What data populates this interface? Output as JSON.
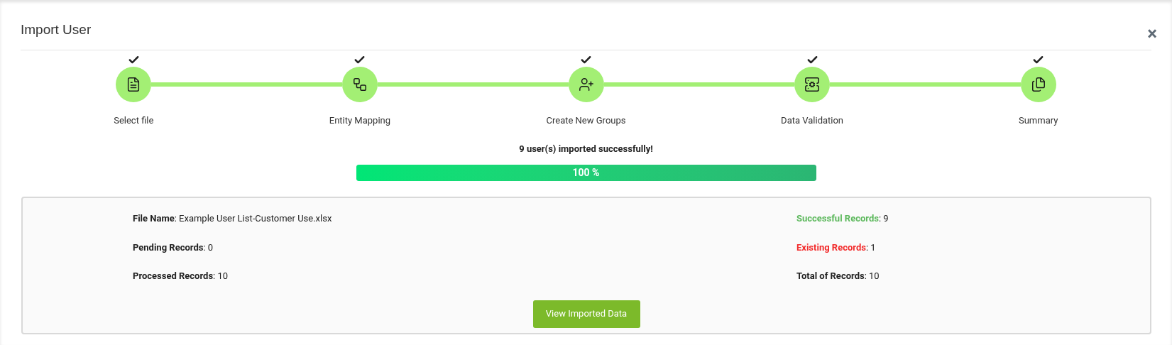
{
  "dialog": {
    "title": "Import User",
    "close": "×"
  },
  "steps": [
    {
      "label": "Select file",
      "completed": true
    },
    {
      "label": "Entity Mapping",
      "completed": true
    },
    {
      "label": "Create New Groups",
      "completed": true
    },
    {
      "label": "Data Validation",
      "completed": true
    },
    {
      "label": "Summary",
      "completed": true
    }
  ],
  "message": "9 user(s) imported successfully!",
  "progress": {
    "level": 1,
    "reading": "100 %"
  },
  "summary": {
    "left": [
      {
        "label": "File Name",
        "value": ": Example User List-Customer Use.xlsx",
        "color": "#212121"
      },
      {
        "label": "Pending Records",
        "value": ": 0",
        "color": "#212121"
      },
      {
        "label": "Processed Records",
        "value": ": 10",
        "color": "#212121"
      }
    ],
    "right": [
      {
        "label": "Successful Records",
        "value": ": 9",
        "color": "#5cb85c"
      },
      {
        "label": "Existing Records",
        "value": ": 1",
        "color": "#f22b2b"
      },
      {
        "label": "Total of Records",
        "value": ": 10",
        "color": "#212121"
      }
    ],
    "button": "View Imported Data"
  }
}
